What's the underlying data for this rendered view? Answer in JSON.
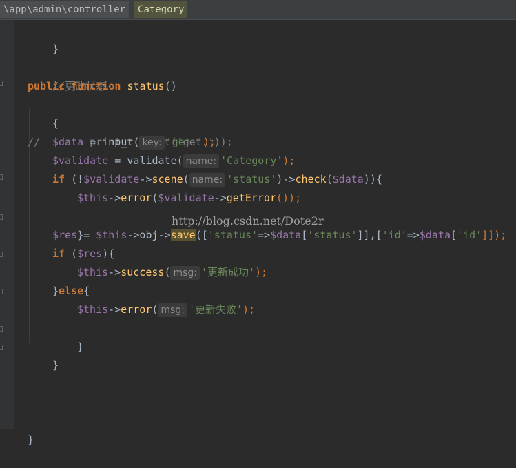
{
  "breadcrumb": {
    "path": "\\app\\admin\\controller",
    "current": "Category"
  },
  "watermark": "http://blog.csdn.net/Dote2r",
  "code": {
    "l1": "}",
    "l2": "//更改状态",
    "l3_kw1": "public",
    "l3_kw2": "function",
    "l3_fn": "status",
    "l3_rest": "()",
    "l4": "{",
    "l5_comment": "//",
    "l5_code": "print_r(input('get.'));",
    "l6_var": "$data",
    "l6_eq": " = input(",
    "l6_hint": "key:",
    "l6_str": "'get.'",
    "l6_end": ");",
    "l7_var": "$validate",
    "l7_eq": " = validate(",
    "l7_hint": "name:",
    "l7_str": "'Category'",
    "l7_end": ");",
    "l8_kw": "if",
    "l8_a": " (!",
    "l8_var": "$validate",
    "l8_b": "->",
    "l8_fn": "scene",
    "l8_c": "(",
    "l8_hint": "name:",
    "l8_str": "'status'",
    "l8_d": ")->",
    "l8_fn2": "check",
    "l8_e": "(",
    "l8_var2": "$data",
    "l8_f": ")){",
    "l9_var": "$this",
    "l9_a": "->",
    "l9_fn": "error",
    "l9_b": "(",
    "l9_var2": "$validate",
    "l9_c": "->",
    "l9_fn2": "getError",
    "l9_d": "());",
    "l10": "}",
    "l11_var": "$res",
    "l11_a": " = ",
    "l11_var2": "$this",
    "l11_b": "->obj->",
    "l11_fn": "save",
    "l11_c": "([",
    "l11_s1": "'status'",
    "l11_d": "=>",
    "l11_var3": "$data",
    "l11_e": "[",
    "l11_s2": "'status'",
    "l11_f": "]],[",
    "l11_s3": "'id'",
    "l11_g": "=>",
    "l11_var4": "$data",
    "l11_h": "[",
    "l11_s4": "'id'",
    "l11_i": "]]);",
    "l12_kw": "if",
    "l12_a": " (",
    "l12_var": "$res",
    "l12_b": "){",
    "l13_var": "$this",
    "l13_a": "->",
    "l13_fn": "success",
    "l13_b": "(",
    "l13_hint": "msg:",
    "l13_str": "'更新成功'",
    "l13_end": ");",
    "l14_a": "}",
    "l14_kw": "else",
    "l14_b": "{",
    "l15_var": "$this",
    "l15_a": "->",
    "l15_fn": "error",
    "l15_b": "(",
    "l15_hint": "msg:",
    "l15_str": "'更新失败'",
    "l15_end": ");",
    "l16": "}",
    "l17": "}",
    "l18": "}"
  }
}
